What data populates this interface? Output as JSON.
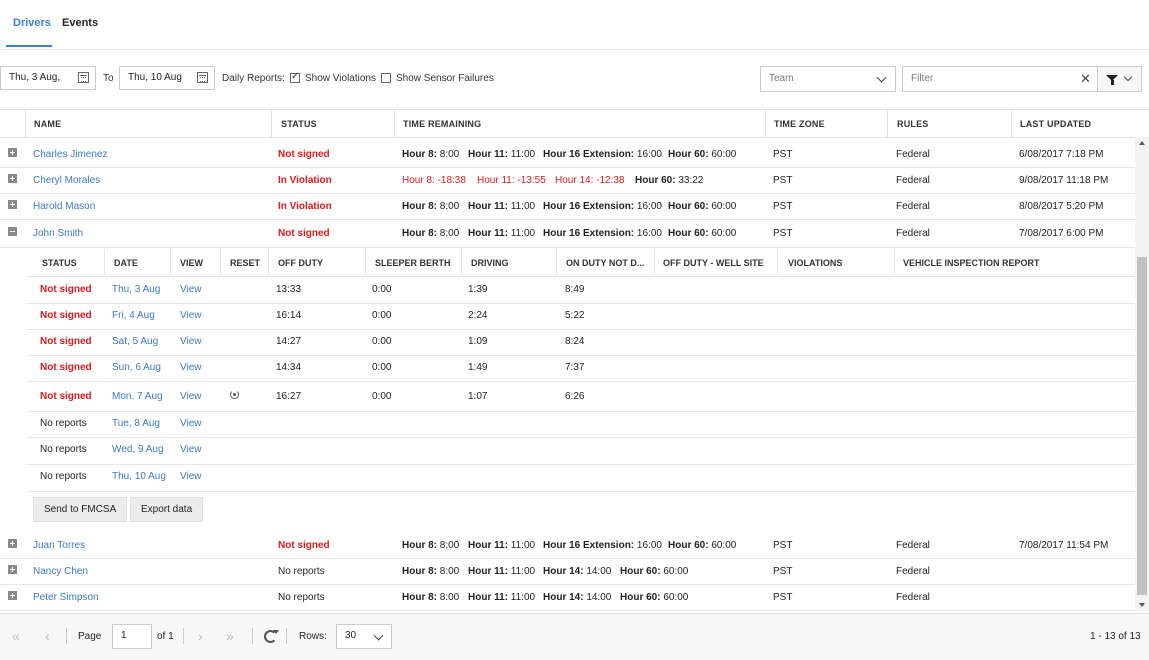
{
  "tabs": {
    "drivers": "Drivers",
    "events": "Events"
  },
  "toolbar": {
    "date_from": "Thu, 3 Aug,",
    "to_label": "To",
    "date_to": "Thu, 10 Aug",
    "daily_reports_label": "Daily Reports:",
    "show_violations_label": "Show Violations",
    "show_violations_checked": true,
    "show_sensor_failures_label": "Show Sensor Failures",
    "show_sensor_failures_checked": false,
    "team_placeholder": "Team",
    "filter_placeholder": "Filter"
  },
  "columns": [
    "NAME",
    "STATUS",
    "TIME REMAINING",
    "TIME ZONE",
    "RULES",
    "LAST UPDATED"
  ],
  "drivers": [
    {
      "name": "Charles Jimenez",
      "status": "Not signed",
      "tr": [
        [
          "Hour 8:",
          "8:00"
        ],
        [
          "Hour 11:",
          "11:00"
        ],
        [
          "Hour 16 Extension:",
          "16:00"
        ],
        [
          "Hour 60:",
          "60:00"
        ]
      ],
      "tz": "PST",
      "rules": "Federal",
      "updated": "6/08/2017 7:18 PM"
    },
    {
      "name": "Cheryl Morales",
      "status": "In Violation",
      "tr": [
        [
          "Hour 8:",
          "-18:38"
        ],
        [
          "Hour 11:",
          "-13:55"
        ],
        [
          "Hour 14:",
          "-12:38"
        ],
        [
          "Hour 60:",
          "33:22"
        ]
      ],
      "tz": "PST",
      "rules": "Federal",
      "updated": "9/08/2017 11:18 PM"
    },
    {
      "name": "Harold Mason",
      "status": "In Violation",
      "tr": [
        [
          "Hour 8:",
          "8:00"
        ],
        [
          "Hour 11:",
          "11:00"
        ],
        [
          "Hour 16 Extension:",
          "16:00"
        ],
        [
          "Hour 60:",
          "60:00"
        ]
      ],
      "tz": "PST",
      "rules": "Federal",
      "updated": "8/08/2017 5:20 PM"
    },
    {
      "name": "John Smith",
      "status": "Not signed",
      "tr": [
        [
          "Hour 8:",
          "8:00"
        ],
        [
          "Hour 11:",
          "11:00"
        ],
        [
          "Hour 16 Extension:",
          "16:00"
        ],
        [
          "Hour 60:",
          "60:00"
        ]
      ],
      "tz": "PST",
      "rules": "Federal",
      "updated": "7/08/2017 6:00 PM"
    },
    {
      "name": "Juan Torres",
      "status": "Not signed",
      "tr": [
        [
          "Hour 8:",
          "8:00"
        ],
        [
          "Hour 11:",
          "11:00"
        ],
        [
          "Hour 16 Extension:",
          "16:00"
        ],
        [
          "Hour 60:",
          "60:00"
        ]
      ],
      "tz": "PST",
      "rules": "Federal",
      "updated": "7/08/2017 11:54 PM"
    },
    {
      "name": "Nancy Chen",
      "status": "No reports",
      "tr": [
        [
          "Hour 8:",
          "8:00"
        ],
        [
          "Hour 11:",
          "11:00"
        ],
        [
          "Hour 14:",
          "14:00"
        ],
        [
          "Hour 60:",
          "60:00"
        ]
      ],
      "tz": "PST",
      "rules": "Federal",
      "updated": ""
    },
    {
      "name": "Peter Simpson",
      "status": "No reports",
      "tr": [
        [
          "Hour 8:",
          "8:00"
        ],
        [
          "Hour 11:",
          "11:00"
        ],
        [
          "Hour 14:",
          "14:00"
        ],
        [
          "Hour 60:",
          "60:00"
        ]
      ],
      "tz": "PST",
      "rules": "Federal",
      "updated": ""
    }
  ],
  "sub_columns": [
    "STATUS",
    "DATE",
    "VIEW",
    "RESET",
    "OFF DUTY",
    "SLEEPER BERTH",
    "DRIVING",
    "ON DUTY NOT D...",
    "OFF DUTY - WELL SITE",
    "VIOLATIONS",
    "VEHICLE INSPECTION REPORT"
  ],
  "daily_reports": [
    {
      "status": "Not signed",
      "date": "Thu, 3 Aug",
      "view": "View",
      "reset": false,
      "off_duty": "13:33",
      "sleeper": "0:00",
      "driving": "1:39",
      "on_duty": "8:49"
    },
    {
      "status": "Not signed",
      "date": "Fri, 4 Aug",
      "view": "View",
      "reset": false,
      "off_duty": "16:14",
      "sleeper": "0:00",
      "driving": "2:24",
      "on_duty": "5:22"
    },
    {
      "status": "Not signed",
      "date": "Sat, 5 Aug",
      "view": "View",
      "reset": false,
      "off_duty": "14:27",
      "sleeper": "0:00",
      "driving": "1:09",
      "on_duty": "8:24"
    },
    {
      "status": "Not signed",
      "date": "Sun, 6 Aug",
      "view": "View",
      "reset": false,
      "off_duty": "14:34",
      "sleeper": "0:00",
      "driving": "1:49",
      "on_duty": "7:37"
    },
    {
      "status": "Not signed",
      "date": "Mon, 7 Aug",
      "view": "View",
      "reset": true,
      "off_duty": "16:27",
      "sleeper": "0:00",
      "driving": "1:07",
      "on_duty": "6:26"
    },
    {
      "status": "No reports",
      "date": "Tue, 8 Aug",
      "view": "View",
      "reset": false,
      "off_duty": "",
      "sleeper": "",
      "driving": "",
      "on_duty": ""
    },
    {
      "status": "No reports",
      "date": "Wed, 9 Aug",
      "view": "View",
      "reset": false,
      "off_duty": "",
      "sleeper": "",
      "driving": "",
      "on_duty": ""
    },
    {
      "status": "No reports",
      "date": "Thu, 10 Aug",
      "view": "View",
      "reset": false,
      "off_duty": "",
      "sleeper": "",
      "driving": "",
      "on_duty": ""
    }
  ],
  "actions": {
    "send_fmcsa": "Send to FMCSA",
    "export": "Export data"
  },
  "pager": {
    "page_label": "Page",
    "page_value": "1",
    "of_label": "of 1",
    "rows_label": "Rows:",
    "rows_value": "30",
    "summary": "1 - 13 of 13"
  },
  "colors": {
    "accent": "#3b82d6",
    "link": "#3b78c8",
    "alert": "#e0191b"
  }
}
